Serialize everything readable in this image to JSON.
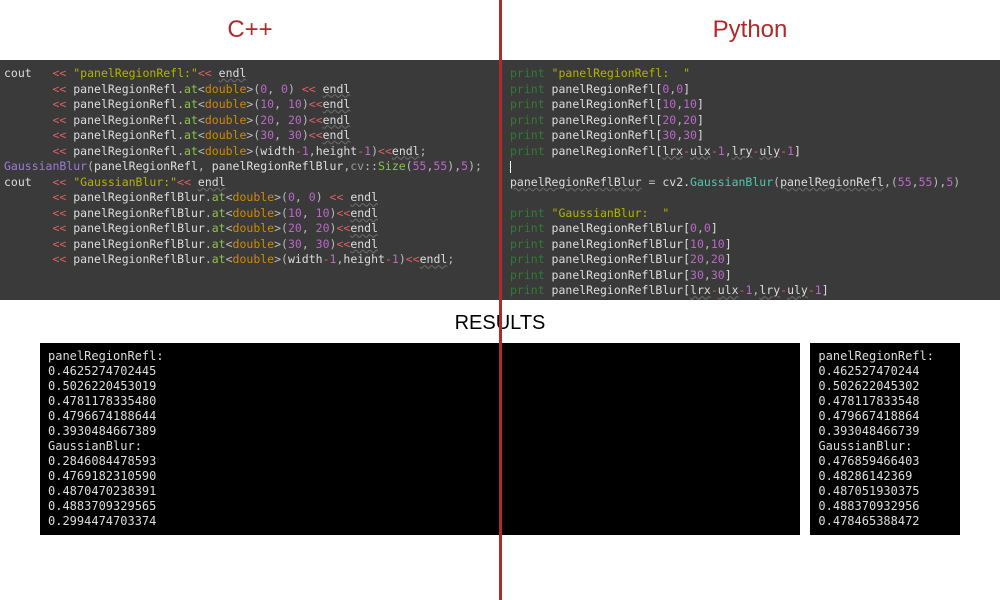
{
  "headers": {
    "cpp": "C++",
    "python": "Python"
  },
  "results_label": "RESULTS",
  "cpp_code": [
    [
      [
        "p-var",
        "cout   "
      ],
      [
        "op",
        "<< "
      ],
      [
        "str",
        "\"panelRegionRefl:\""
      ],
      [
        "op",
        "<< "
      ],
      [
        "und",
        "endl"
      ]
    ],
    [
      [
        "p-var",
        "       "
      ],
      [
        "op",
        "<< "
      ],
      [
        "p-var",
        "panelRegionRefl"
      ],
      [
        "p-f",
        "."
      ],
      [
        "type",
        "at"
      ],
      [
        "p-f",
        "<"
      ],
      [
        "kw-o",
        "double"
      ],
      [
        "p-f",
        ">("
      ],
      [
        "lit",
        "0"
      ],
      [
        "p-f",
        ", "
      ],
      [
        "lit",
        "0"
      ],
      [
        "p-f",
        ") "
      ],
      [
        "op",
        "<< "
      ],
      [
        "und",
        "endl"
      ]
    ],
    [
      [
        "p-var",
        "       "
      ],
      [
        "op",
        "<< "
      ],
      [
        "p-var",
        "panelRegionRefl"
      ],
      [
        "p-f",
        "."
      ],
      [
        "type",
        "at"
      ],
      [
        "p-f",
        "<"
      ],
      [
        "kw-o",
        "double"
      ],
      [
        "p-f",
        ">("
      ],
      [
        "lit",
        "10"
      ],
      [
        "p-f",
        ", "
      ],
      [
        "lit",
        "10"
      ],
      [
        "p-f",
        ")"
      ],
      [
        "op",
        "<<"
      ],
      [
        "und",
        "endl"
      ]
    ],
    [
      [
        "p-var",
        "       "
      ],
      [
        "op",
        "<< "
      ],
      [
        "p-var",
        "panelRegionRefl"
      ],
      [
        "p-f",
        "."
      ],
      [
        "type",
        "at"
      ],
      [
        "p-f",
        "<"
      ],
      [
        "kw-o",
        "double"
      ],
      [
        "p-f",
        ">("
      ],
      [
        "lit",
        "20"
      ],
      [
        "p-f",
        ", "
      ],
      [
        "lit",
        "20"
      ],
      [
        "p-f",
        ")"
      ],
      [
        "op",
        "<<"
      ],
      [
        "und",
        "endl"
      ]
    ],
    [
      [
        "p-var",
        "       "
      ],
      [
        "op",
        "<< "
      ],
      [
        "p-var",
        "panelRegionRefl"
      ],
      [
        "p-f",
        "."
      ],
      [
        "type",
        "at"
      ],
      [
        "p-f",
        "<"
      ],
      [
        "kw-o",
        "double"
      ],
      [
        "p-f",
        ">("
      ],
      [
        "lit",
        "30"
      ],
      [
        "p-f",
        ", "
      ],
      [
        "lit",
        "30"
      ],
      [
        "p-f",
        ")"
      ],
      [
        "op",
        "<<"
      ],
      [
        "und",
        "endl"
      ]
    ],
    [
      [
        "p-var",
        "       "
      ],
      [
        "op",
        "<< "
      ],
      [
        "p-var",
        "panelRegionRefl"
      ],
      [
        "p-f",
        "."
      ],
      [
        "type",
        "at"
      ],
      [
        "p-f",
        "<"
      ],
      [
        "kw-o",
        "double"
      ],
      [
        "p-f",
        ">("
      ],
      [
        "p-var",
        "width"
      ],
      [
        "op",
        "-"
      ],
      [
        "lit",
        "1"
      ],
      [
        "p-f",
        ","
      ],
      [
        "p-var",
        "height"
      ],
      [
        "op",
        "-"
      ],
      [
        "lit",
        "1"
      ],
      [
        "p-f",
        ")"
      ],
      [
        "op",
        "<<"
      ],
      [
        "und",
        "endl"
      ],
      [
        "p-f",
        ";"
      ]
    ],
    [
      [
        "fn",
        "GaussianBlur"
      ],
      [
        "p-f",
        "("
      ],
      [
        "p-var",
        "panelRegionRefl"
      ],
      [
        "p-f",
        ", "
      ],
      [
        "p-var",
        "panelRegionReflBlur"
      ],
      [
        "p-f",
        ","
      ],
      [
        "p-ns",
        "cv"
      ],
      [
        "p-f",
        "::"
      ],
      [
        "type",
        "Size"
      ],
      [
        "p-f",
        "("
      ],
      [
        "lit",
        "55"
      ],
      [
        "p-f",
        ","
      ],
      [
        "lit",
        "55"
      ],
      [
        "p-f",
        "),"
      ],
      [
        "lit",
        "5"
      ],
      [
        "p-f",
        ");"
      ]
    ],
    [
      [
        "p-var",
        "cout   "
      ],
      [
        "op",
        "<< "
      ],
      [
        "str",
        "\"GaussianBlur:\""
      ],
      [
        "op",
        "<< "
      ],
      [
        "und",
        "endl"
      ]
    ],
    [
      [
        "p-var",
        "       "
      ],
      [
        "op",
        "<< "
      ],
      [
        "p-var",
        "panelRegionReflBlur"
      ],
      [
        "p-f",
        "."
      ],
      [
        "type",
        "at"
      ],
      [
        "p-f",
        "<"
      ],
      [
        "kw-o",
        "double"
      ],
      [
        "p-f",
        ">("
      ],
      [
        "lit",
        "0"
      ],
      [
        "p-f",
        ", "
      ],
      [
        "lit",
        "0"
      ],
      [
        "p-f",
        ") "
      ],
      [
        "op",
        "<< "
      ],
      [
        "und",
        "endl"
      ]
    ],
    [
      [
        "p-var",
        "       "
      ],
      [
        "op",
        "<< "
      ],
      [
        "p-var",
        "panelRegionReflBlur"
      ],
      [
        "p-f",
        "."
      ],
      [
        "type",
        "at"
      ],
      [
        "p-f",
        "<"
      ],
      [
        "kw-o",
        "double"
      ],
      [
        "p-f",
        ">("
      ],
      [
        "lit",
        "10"
      ],
      [
        "p-f",
        ", "
      ],
      [
        "lit",
        "10"
      ],
      [
        "p-f",
        ")"
      ],
      [
        "op",
        "<<"
      ],
      [
        "und",
        "endl"
      ]
    ],
    [
      [
        "p-var",
        "       "
      ],
      [
        "op",
        "<< "
      ],
      [
        "p-var",
        "panelRegionReflBlur"
      ],
      [
        "p-f",
        "."
      ],
      [
        "type",
        "at"
      ],
      [
        "p-f",
        "<"
      ],
      [
        "kw-o",
        "double"
      ],
      [
        "p-f",
        ">("
      ],
      [
        "lit",
        "20"
      ],
      [
        "p-f",
        ", "
      ],
      [
        "lit",
        "20"
      ],
      [
        "p-f",
        ")"
      ],
      [
        "op",
        "<<"
      ],
      [
        "und",
        "endl"
      ]
    ],
    [
      [
        "p-var",
        "       "
      ],
      [
        "op",
        "<< "
      ],
      [
        "p-var",
        "panelRegionReflBlur"
      ],
      [
        "p-f",
        "."
      ],
      [
        "type",
        "at"
      ],
      [
        "p-f",
        "<"
      ],
      [
        "kw-o",
        "double"
      ],
      [
        "p-f",
        ">("
      ],
      [
        "lit",
        "30"
      ],
      [
        "p-f",
        ", "
      ],
      [
        "lit",
        "30"
      ],
      [
        "p-f",
        ")"
      ],
      [
        "op",
        "<<"
      ],
      [
        "und",
        "endl"
      ]
    ],
    [
      [
        "p-var",
        "       "
      ],
      [
        "op",
        "<< "
      ],
      [
        "p-var",
        "panelRegionReflBlur"
      ],
      [
        "p-f",
        "."
      ],
      [
        "type",
        "at"
      ],
      [
        "p-f",
        "<"
      ],
      [
        "kw-o",
        "double"
      ],
      [
        "p-f",
        ">("
      ],
      [
        "p-var",
        "width"
      ],
      [
        "op",
        "-"
      ],
      [
        "lit",
        "1"
      ],
      [
        "p-f",
        ","
      ],
      [
        "p-var",
        "height"
      ],
      [
        "op",
        "-"
      ],
      [
        "lit",
        "1"
      ],
      [
        "p-f",
        ")"
      ],
      [
        "op",
        "<<"
      ],
      [
        "und",
        "endl"
      ],
      [
        "p-f",
        ";"
      ]
    ]
  ],
  "py_code": [
    [
      [
        "kw",
        "print "
      ],
      [
        "str",
        "\"panelRegionRefl:  \""
      ]
    ],
    [
      [
        "kw",
        "print "
      ],
      [
        "p-var",
        "panelRegionRefl["
      ],
      [
        "lit",
        "0"
      ],
      [
        "p-f",
        ","
      ],
      [
        "lit",
        "0"
      ],
      [
        "p-var",
        "]"
      ]
    ],
    [
      [
        "kw",
        "print "
      ],
      [
        "p-var",
        "panelRegionRefl["
      ],
      [
        "lit",
        "10"
      ],
      [
        "p-f",
        ","
      ],
      [
        "lit",
        "10"
      ],
      [
        "p-var",
        "]"
      ]
    ],
    [
      [
        "kw",
        "print "
      ],
      [
        "p-var",
        "panelRegionRefl["
      ],
      [
        "lit",
        "20"
      ],
      [
        "p-f",
        ","
      ],
      [
        "lit",
        "20"
      ],
      [
        "p-var",
        "]"
      ]
    ],
    [
      [
        "kw",
        "print "
      ],
      [
        "p-var",
        "panelRegionRefl["
      ],
      [
        "lit",
        "30"
      ],
      [
        "p-f",
        ","
      ],
      [
        "lit",
        "30"
      ],
      [
        "p-var",
        "]"
      ]
    ],
    [
      [
        "kw",
        "print "
      ],
      [
        "p-var",
        "panelRegionRefl["
      ],
      [
        "und",
        "lrx"
      ],
      [
        "op",
        "-"
      ],
      [
        "und",
        "ulx"
      ],
      [
        "op",
        "-"
      ],
      [
        "lit",
        "1"
      ],
      [
        "p-f",
        ","
      ],
      [
        "und",
        "lry"
      ],
      [
        "op",
        "-"
      ],
      [
        "und",
        "uly"
      ],
      [
        "op",
        "-"
      ],
      [
        "lit",
        "1"
      ],
      [
        "p-var",
        "]"
      ]
    ],
    [
      [
        "cursor",
        ""
      ]
    ],
    [
      [
        "p-def",
        "panelRegionReflBlur"
      ],
      [
        "p-f",
        " = "
      ],
      [
        "p-var",
        "cv2."
      ],
      [
        "fn2",
        "GaussianBlur"
      ],
      [
        "p-f",
        "("
      ],
      [
        "und",
        "panelRegionRefl"
      ],
      [
        "p-f",
        ",("
      ],
      [
        "lit",
        "55"
      ],
      [
        "p-f",
        ","
      ],
      [
        "lit",
        "55"
      ],
      [
        "p-f",
        "),"
      ],
      [
        "lit",
        "5"
      ],
      [
        "p-f",
        ")"
      ]
    ],
    [
      [
        "",
        ""
      ]
    ],
    [
      [
        "kw",
        "print "
      ],
      [
        "str",
        "\"GaussianBlur:  \""
      ]
    ],
    [
      [
        "kw",
        "print "
      ],
      [
        "p-var",
        "panelRegionReflBlur["
      ],
      [
        "lit",
        "0"
      ],
      [
        "p-f",
        ","
      ],
      [
        "lit",
        "0"
      ],
      [
        "p-var",
        "]"
      ]
    ],
    [
      [
        "kw",
        "print "
      ],
      [
        "p-var",
        "panelRegionReflBlur["
      ],
      [
        "lit",
        "10"
      ],
      [
        "p-f",
        ","
      ],
      [
        "lit",
        "10"
      ],
      [
        "p-var",
        "]"
      ]
    ],
    [
      [
        "kw",
        "print "
      ],
      [
        "p-var",
        "panelRegionReflBlur["
      ],
      [
        "lit",
        "20"
      ],
      [
        "p-f",
        ","
      ],
      [
        "lit",
        "20"
      ],
      [
        "p-var",
        "]"
      ]
    ],
    [
      [
        "kw",
        "print "
      ],
      [
        "p-var",
        "panelRegionReflBlur["
      ],
      [
        "lit",
        "30"
      ],
      [
        "p-f",
        ","
      ],
      [
        "lit",
        "30"
      ],
      [
        "p-var",
        "]"
      ]
    ],
    [
      [
        "kw",
        "print "
      ],
      [
        "p-var",
        "panelRegionReflBlur["
      ],
      [
        "und",
        "lrx"
      ],
      [
        "op",
        "-"
      ],
      [
        "und",
        "ulx"
      ],
      [
        "op",
        "-"
      ],
      [
        "lit",
        "1"
      ],
      [
        "p-f",
        ","
      ],
      [
        "und",
        "lry"
      ],
      [
        "op",
        "-"
      ],
      [
        "und",
        "uly"
      ],
      [
        "op",
        "-"
      ],
      [
        "lit",
        "1"
      ],
      [
        "p-var",
        "]"
      ]
    ]
  ],
  "results_left": [
    "panelRegionRefl:",
    "0.4625274702445",
    "0.5026220453019",
    "0.4781178335480",
    "0.4796674188644",
    "0.3930484667389",
    "GaussianBlur:",
    "0.2846084478593",
    "0.4769182310590",
    "0.4870470238391",
    "0.4883709329565",
    "0.2994474703374"
  ],
  "results_right": [
    "panelRegionRefl:",
    "0.462527470244",
    "0.502622045302",
    "0.478117833548",
    "0.479667418864",
    "0.393048466739",
    "GaussianBlur:",
    "0.476859466403",
    "0.48286142369",
    "0.487051930375",
    "0.488370932956",
    "0.478465388472"
  ]
}
